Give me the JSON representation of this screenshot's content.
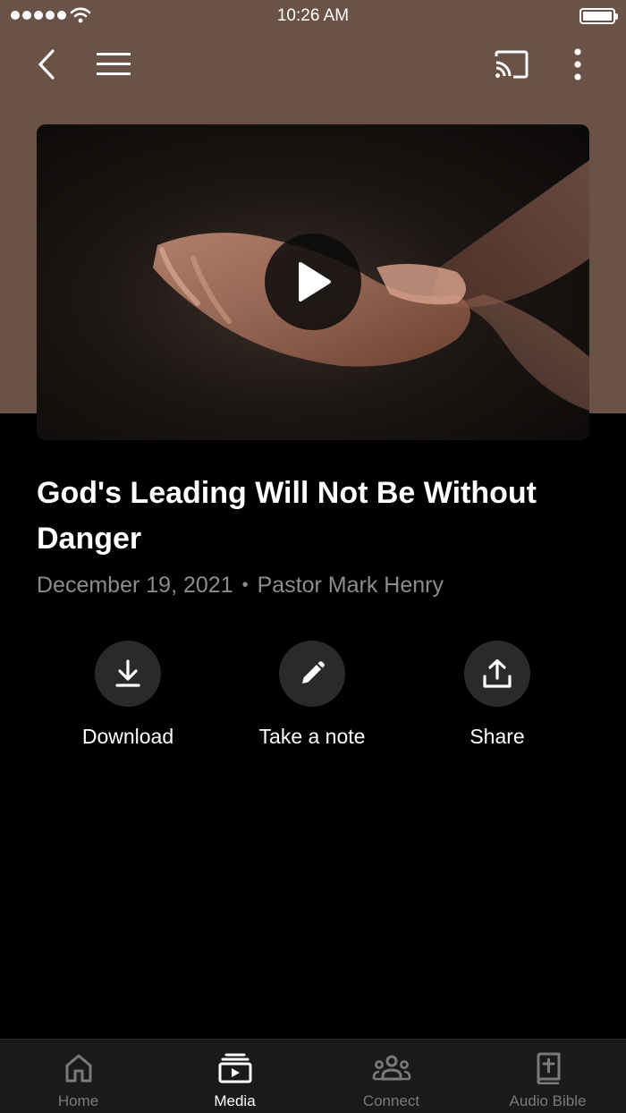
{
  "status_bar": {
    "time": "10:26 AM"
  },
  "navbar": {
    "back_icon": "chevron-left-icon",
    "menu_icon": "hamburger-menu-icon",
    "cast_icon": "cast-icon",
    "more_icon": "more-vertical-icon"
  },
  "video": {
    "play_icon": "play-icon"
  },
  "sermon": {
    "title": "God's Leading Will Not Be Without Danger",
    "date": "December 19, 2021",
    "separator": "•",
    "speaker": "Pastor Mark Henry"
  },
  "actions": [
    {
      "label": "Download",
      "icon": "download-icon"
    },
    {
      "label": "Take a note",
      "icon": "pencil-icon"
    },
    {
      "label": "Share",
      "icon": "share-icon"
    }
  ],
  "tabs": [
    {
      "label": "Home",
      "icon": "home-icon",
      "active": false
    },
    {
      "label": "Media",
      "icon": "media-icon",
      "active": true
    },
    {
      "label": "Connect",
      "icon": "connect-icon",
      "active": false
    },
    {
      "label": "Audio Bible",
      "icon": "bible-icon",
      "active": false
    }
  ],
  "colors": {
    "header_background": "#6a5247",
    "page_background": "#000000",
    "tabbar_background": "#1a1a1a",
    "inactive_tab": "#7a7a7a",
    "active_tab": "#ffffff",
    "meta_text": "#8c8c8c"
  }
}
